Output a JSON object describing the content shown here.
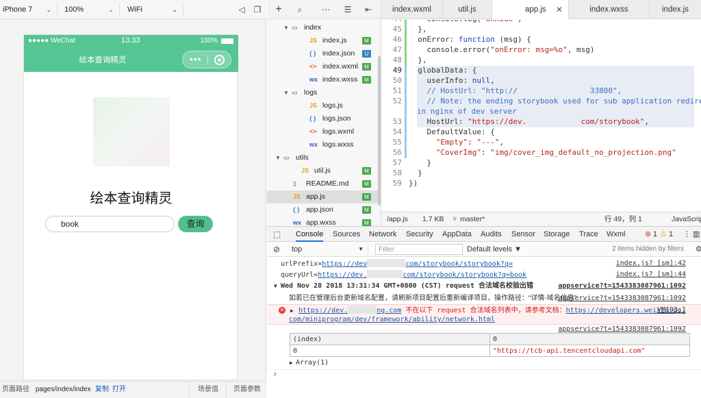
{
  "simulator": {
    "toolbar": {
      "device": "iPhone 7",
      "zoom": "100%",
      "network": "WiFi"
    },
    "status_bar": {
      "carrier": "●●●●● WeChat",
      "time": "13:33",
      "battery": "100%"
    },
    "nav_title": "绘本查询精灵",
    "page": {
      "heading": "绘本查询精灵",
      "search_value": "book",
      "search_button": "查询"
    },
    "footer": {
      "path_label": "页面路径",
      "path": "pages/index/index",
      "copy": "复制",
      "open": "打开",
      "scene": "场景值",
      "params": "页面参数"
    }
  },
  "file_tree": [
    {
      "name": "index",
      "type": "folder",
      "indent": 1
    },
    {
      "name": "index.js",
      "type": "js",
      "badge": "M",
      "indent": 2
    },
    {
      "name": "index.json",
      "type": "json",
      "badge": "U",
      "indent": 2
    },
    {
      "name": "index.wxml",
      "type": "wxml",
      "badge": "M",
      "indent": 2
    },
    {
      "name": "index.wxss",
      "type": "wxss",
      "badge": "M",
      "indent": 2
    },
    {
      "name": "logs",
      "type": "folder",
      "indent": 1
    },
    {
      "name": "logs.js",
      "type": "js",
      "indent": 2
    },
    {
      "name": "logs.json",
      "type": "json",
      "indent": 2
    },
    {
      "name": "logs.wxml",
      "type": "wxml",
      "indent": 2
    },
    {
      "name": "logs.wxss",
      "type": "wxss",
      "indent": 2
    },
    {
      "name": "utils",
      "type": "folder",
      "indent": 0
    },
    {
      "name": "util.js",
      "type": "js",
      "badge": "M",
      "indent": 1
    },
    {
      "name": "README.md",
      "type": "md",
      "badge": "M",
      "indent": 0
    },
    {
      "name": "app.js",
      "type": "js",
      "badge": "M",
      "indent": 0,
      "active": true
    },
    {
      "name": "app.json",
      "type": "json",
      "badge": "M",
      "indent": 0
    },
    {
      "name": "app.wxss",
      "type": "wxss",
      "badge": "M",
      "indent": 0
    }
  ],
  "editor": {
    "tabs": [
      {
        "label": "index.wxml"
      },
      {
        "label": "util.js"
      },
      {
        "label": "app.js",
        "active": true
      },
      {
        "label": "index.wxss"
      },
      {
        "label": "index.js"
      }
    ],
    "lines": [
      {
        "n": "44",
        "text": "    console.log('onHide')"
      },
      {
        "n": "45",
        "text": "  },"
      },
      {
        "n": "46",
        "text": "  onError: function (msg) {"
      },
      {
        "n": "47",
        "text": "    console.error(\"onError: msg=%o\", msg)"
      },
      {
        "n": "48",
        "text": "  },"
      },
      {
        "n": "49",
        "text": "  globalData: {"
      },
      {
        "n": "50",
        "text": "    userInfo: null,"
      },
      {
        "n": "51",
        "text": "    // HostUrl: \"http://                33800\","
      },
      {
        "n": "52",
        "text": "    // Note: the ending storybook used for sub application redirect"
      },
      {
        "n": "",
        "text": "in nginx of dev server"
      },
      {
        "n": "53",
        "text": "    HostUrl: \"https://dev.            com/storybook\","
      },
      {
        "n": "54",
        "text": "    DefaultValue: {"
      },
      {
        "n": "55",
        "text": "      \"Empty\": \"---\","
      },
      {
        "n": "56",
        "text": "      \"CoverImg\": \"img/cover_img_default_no_projection.png\""
      },
      {
        "n": "57",
        "text": "    }"
      },
      {
        "n": "58",
        "text": "  }"
      },
      {
        "n": "59",
        "text": "})"
      }
    ],
    "status": {
      "path": "/app.js",
      "size": "1.7 KB",
      "branch": "master*",
      "cursor": "行 49，列 1",
      "language": "JavaScript"
    }
  },
  "devtools": {
    "tabs": [
      "Console",
      "Sources",
      "Network",
      "Security",
      "AppData",
      "Audits",
      "Sensor",
      "Storage",
      "Trace",
      "Wxml"
    ],
    "error_count": "1",
    "warning_count": "1",
    "context": "top",
    "filter_placeholder": "Filter",
    "levels": "Default levels ▼",
    "hidden": "2 items hidden by filters",
    "logs": {
      "l1": {
        "prefix": "urlPrefix=",
        "url_a": "https://dev",
        "url_b": "com/storybook/storybook?q=",
        "src": "index.js? [sm]:42"
      },
      "l2": {
        "prefix": "queryUrl=",
        "url_a": "https://dev.",
        "url_b": "com/storybook/storybook?q=book",
        "src": "index.js? [sm]:44"
      },
      "l3": {
        "text": "Wed Nov 28 2018 13:31:34 GMT+0800 (CST) request 合法域名校验出错",
        "src": "appservice?t=1543383087961:1092"
      },
      "l4": {
        "text": "如若已在管理后台更新域名配置，请刷新项目配置后重新编译项目，操作路径：“详情-域名信息”",
        "src": "appservice?t=1543383087961:1092"
      },
      "l5": {
        "url_a": "https://dev.",
        "url_b": "ng.com",
        "text": " 不在以下 request 合法域名列表中，请参考文档：",
        "doc_a": "https://developers.weixin.qq.",
        "doc_b": "com/miniprogram/dev/framework/ability/network.html",
        "src": "VM103:1"
      },
      "l6": {
        "src": "appservice?t=1543383087961:1092"
      }
    },
    "table": {
      "headers": [
        "(index)",
        "0"
      ],
      "row": [
        "0",
        "\"https://tcb-api.tencentcloudapi.com\""
      ],
      "footer": "Array(1)"
    },
    "prompt": "›"
  },
  "colors": {
    "brand_green": "#55c593",
    "button_green": "#4fc08d",
    "badge_green": "#48a84f",
    "error_red": "#d01c1c"
  }
}
